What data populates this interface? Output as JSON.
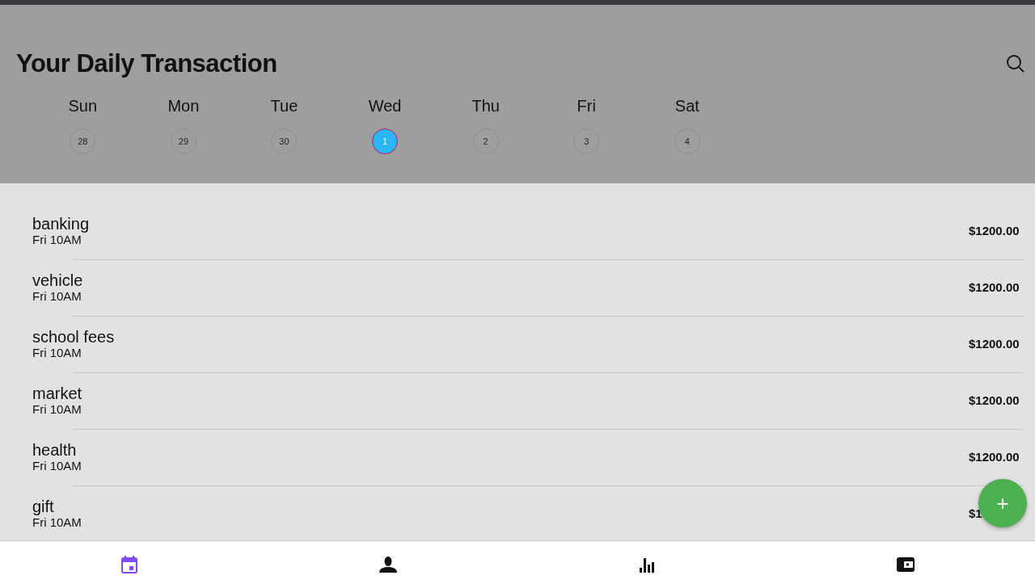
{
  "header": {
    "title": "Your Daily Transaction"
  },
  "week": [
    {
      "day": "Sun",
      "date": "28",
      "selected": false
    },
    {
      "day": "Mon",
      "date": "29",
      "selected": false
    },
    {
      "day": "Tue",
      "date": "30",
      "selected": false
    },
    {
      "day": "Wed",
      "date": "1",
      "selected": true
    },
    {
      "day": "Thu",
      "date": "2",
      "selected": false
    },
    {
      "day": "Fri",
      "date": "3",
      "selected": false
    },
    {
      "day": "Sat",
      "date": "4",
      "selected": false
    }
  ],
  "transactions": [
    {
      "name": "banking",
      "time": "Fri 10AM",
      "amount": "$1200.00"
    },
    {
      "name": "vehicle",
      "time": "Fri 10AM",
      "amount": "$1200.00"
    },
    {
      "name": "school fees",
      "time": "Fri 10AM",
      "amount": "$1200.00"
    },
    {
      "name": "market",
      "time": "Fri 10AM",
      "amount": "$1200.00"
    },
    {
      "name": "health",
      "time": "Fri 10AM",
      "amount": "$1200.00"
    },
    {
      "name": "gift",
      "time": "Fri 10AM",
      "amount": "$1"
    }
  ],
  "fab": {
    "label": "+"
  },
  "bottom_nav": [
    {
      "kind": "calendar",
      "selected": true
    },
    {
      "kind": "person",
      "selected": false
    },
    {
      "kind": "chart",
      "selected": false
    },
    {
      "kind": "wallet",
      "selected": false
    }
  ]
}
